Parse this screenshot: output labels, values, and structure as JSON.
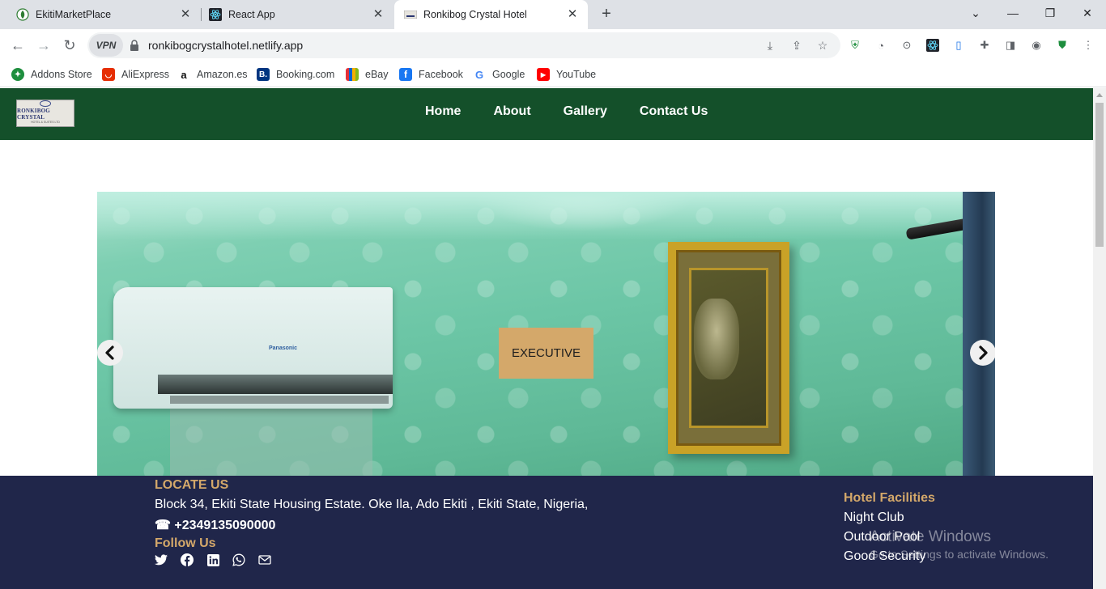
{
  "browser": {
    "tabs": [
      {
        "title": "EkitiMarketPlace"
      },
      {
        "title": "React App"
      },
      {
        "title": "Ronkibog Crystal Hotel"
      }
    ],
    "address": "ronkibogcrystalhotel.netlify.app",
    "vpn_label": "VPN",
    "bookmarks": [
      {
        "label": "Addons Store"
      },
      {
        "label": "AliExpress"
      },
      {
        "label": "Amazon.es"
      },
      {
        "label": "Booking.com"
      },
      {
        "label": "eBay"
      },
      {
        "label": "Facebook"
      },
      {
        "label": "Google"
      },
      {
        "label": "YouTube"
      }
    ]
  },
  "site": {
    "logo": {
      "name": "RONKIBOG CRYSTAL",
      "sub": "HOTEL & SUITES LTD"
    },
    "nav": [
      {
        "label": "Home"
      },
      {
        "label": "About"
      },
      {
        "label": "Gallery"
      },
      {
        "label": "Contact Us"
      }
    ],
    "slider": {
      "label": "EXECUTIVE",
      "ac_brand": "Panasonic"
    },
    "footer": {
      "locate_title": "LOCATE US",
      "address": "Block 34, Ekiti State Housing Estate. Oke Ila, Ado Ekiti , Ekiti State, Nigeria,",
      "phone": "☎ +2349135090000",
      "follow_title": "Follow Us",
      "facilities_title": "Hotel Facilities",
      "facilities": [
        "Night Club",
        "Outdoor Pool",
        "Good Security"
      ]
    },
    "watermark": {
      "line1": "Activate Windows",
      "line2": "Go to Settings to activate Windows."
    }
  },
  "colors": {
    "nav_bg": "#14502a",
    "footer_bg": "#20264a",
    "accent_gold": "#d4a86a"
  }
}
